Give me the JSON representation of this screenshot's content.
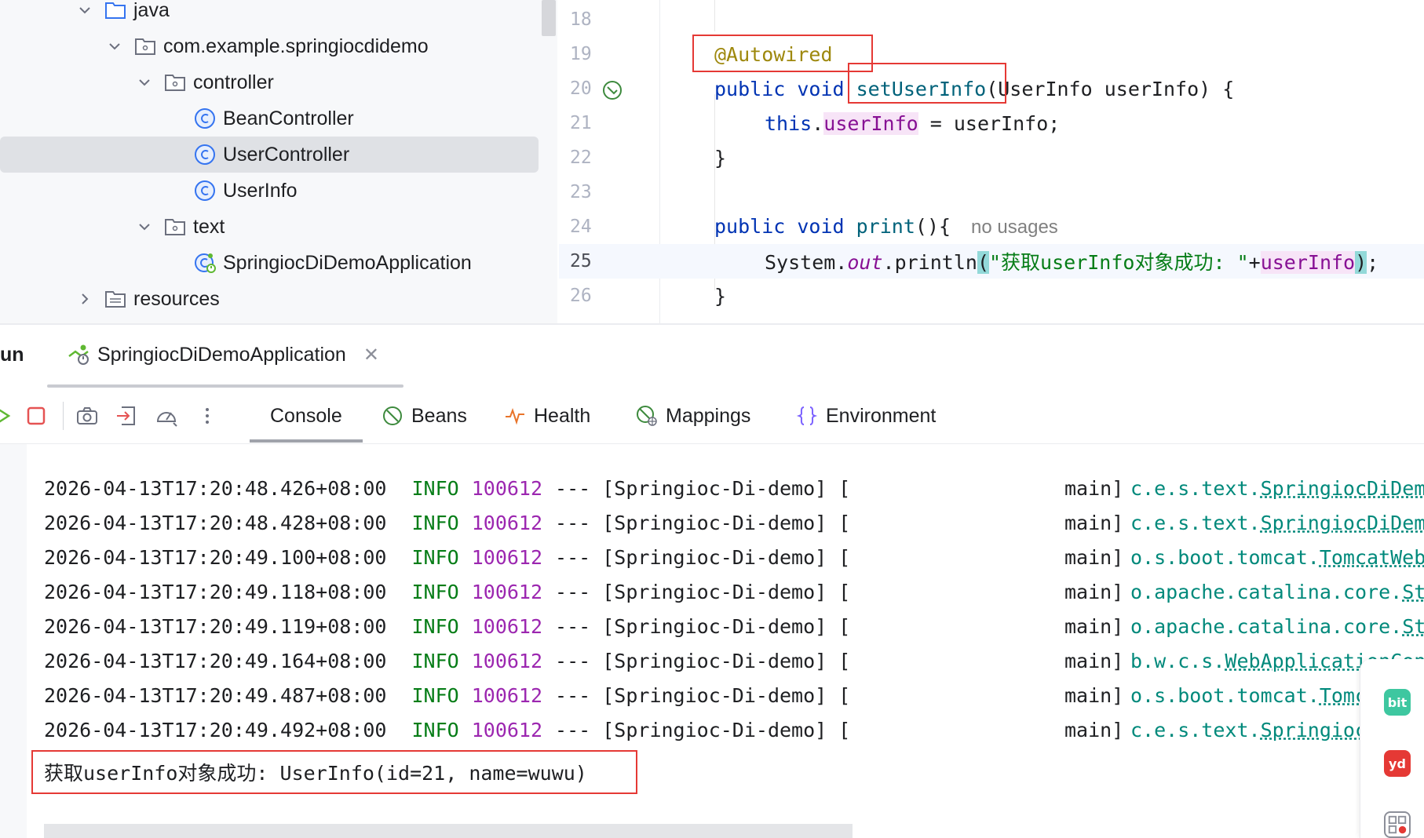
{
  "tree": {
    "items": [
      {
        "label": "java",
        "kind": "folder-source",
        "expanded": true
      },
      {
        "label": "com.example.springiocdidemo",
        "kind": "package",
        "expanded": true
      },
      {
        "label": "controller",
        "kind": "package",
        "expanded": true
      },
      {
        "label": "BeanController",
        "kind": "class"
      },
      {
        "label": "UserController",
        "kind": "class",
        "selected": true
      },
      {
        "label": "UserInfo",
        "kind": "class"
      },
      {
        "label": "text",
        "kind": "package",
        "expanded": true
      },
      {
        "label": "SpringiocDiDemoApplication",
        "kind": "spring-boot-class"
      },
      {
        "label": "resources",
        "kind": "folder-resources",
        "expanded": false
      }
    ]
  },
  "editor": {
    "lines": [
      {
        "n": "18"
      },
      {
        "n": "19",
        "annotation": "@Autowired"
      },
      {
        "n": "20",
        "kw": "public void ",
        "method": "setUserInfo",
        "rest": "(UserInfo userInfo) {"
      },
      {
        "n": "21",
        "kw": "this",
        "dot": ".",
        "field": "userInfo",
        "rest": " = userInfo;"
      },
      {
        "n": "22",
        "rest": "}"
      },
      {
        "n": "23"
      },
      {
        "n": "24",
        "kw": "public void ",
        "method": "print",
        "rest": "(){",
        "hint": "no usages"
      },
      {
        "n": "25",
        "pre": "System.",
        "static_field": "out",
        "call": ".println",
        "paren_open": "(",
        "string": "\"获取userInfo对象成功: \"",
        "plus": "+",
        "field": "userInfo",
        "paren_close": ")",
        "end": ";"
      },
      {
        "n": "26",
        "rest": "}"
      }
    ]
  },
  "run": {
    "label": "un",
    "tab_title": "SpringiocDiDemoApplication",
    "tabs": [
      "Console",
      "Beans",
      "Health",
      "Mappings",
      "Environment"
    ]
  },
  "console": {
    "logs": [
      {
        "ts": "2026-04-13T17:20:48.426+08:00",
        "level": "INFO",
        "pid": "100612",
        "sep": "--- [Springioc-Di-demo] [",
        "thread": "main]",
        "logger_prefix": "c.e.s.text.",
        "logger_name": "SpringiocDiDem"
      },
      {
        "ts": "2026-04-13T17:20:48.428+08:00",
        "level": "INFO",
        "pid": "100612",
        "sep": "--- [Springioc-Di-demo] [",
        "thread": "main]",
        "logger_prefix": "c.e.s.text.",
        "logger_name": "SpringiocDiDem"
      },
      {
        "ts": "2026-04-13T17:20:49.100+08:00",
        "level": "INFO",
        "pid": "100612",
        "sep": "--- [Springioc-Di-demo] [",
        "thread": "main]",
        "logger_prefix": "o.s.boot.tomcat.",
        "logger_name": "TomcatWeb"
      },
      {
        "ts": "2026-04-13T17:20:49.118+08:00",
        "level": "INFO",
        "pid": "100612",
        "sep": "--- [Springioc-Di-demo] [",
        "thread": "main]",
        "logger_prefix": "o.apache.catalina.core.",
        "logger_name": "St"
      },
      {
        "ts": "2026-04-13T17:20:49.119+08:00",
        "level": "INFO",
        "pid": "100612",
        "sep": "--- [Springioc-Di-demo] [",
        "thread": "main]",
        "logger_prefix": "o.apache.catalina.core.",
        "logger_name": "St"
      },
      {
        "ts": "2026-04-13T17:20:49.164+08:00",
        "level": "INFO",
        "pid": "100612",
        "sep": "--- [Springioc-Di-demo] [",
        "thread": "main]",
        "logger_prefix": "b.w.c.s.",
        "logger_name": "WebApplicationCon"
      },
      {
        "ts": "2026-04-13T17:20:49.487+08:00",
        "level": "INFO",
        "pid": "100612",
        "sep": "--- [Springioc-Di-demo] [",
        "thread": "main]",
        "logger_prefix": "o.s.boot.tomcat.",
        "logger_name": "Tomc"
      },
      {
        "ts": "2026-04-13T17:20:49.492+08:00",
        "level": "INFO",
        "pid": "100612",
        "sep": "--- [Springioc-Di-demo] [",
        "thread": "main]",
        "logger_prefix": "c.e.s.text.",
        "logger_name": "Springioc"
      }
    ],
    "output": "获取userInfo对象成功: UserInfo(id=21, name=wuwu)"
  },
  "dock": {
    "bit_label": "bit",
    "yd_label": "yd"
  },
  "colors": {
    "keyword": "#0033b3",
    "annotation": "#9e880d",
    "string": "#067d17",
    "field": "#871094",
    "highlight_box": "#e53935"
  }
}
